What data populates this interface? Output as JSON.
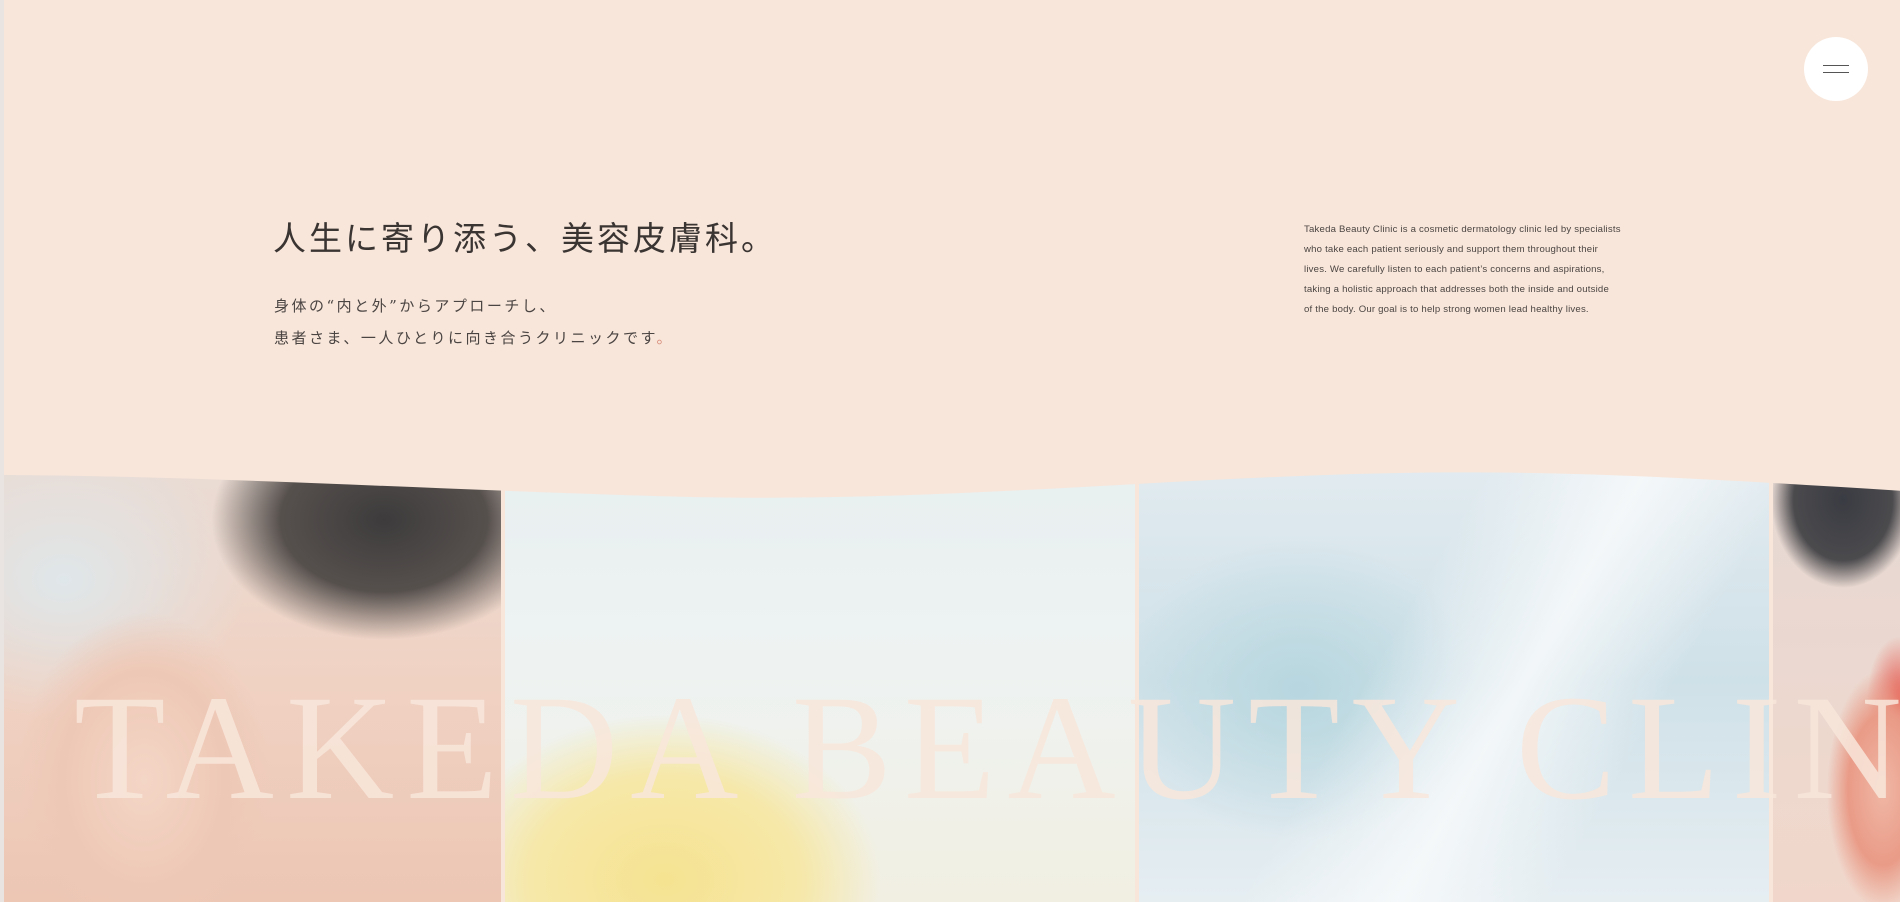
{
  "header": {
    "menu_icon": "hamburger-menu-icon"
  },
  "hero": {
    "headline": "人生に寄り添う、美容皮膚科。",
    "subline_1": "身体の“内と外”からアプローチし、",
    "subline_2_main": "患者さま、一人ひとりに向き合うクリニックです",
    "subline_2_end": "。"
  },
  "about": {
    "lines": [
      "Takeda Beauty Clinic is a cosmetic dermatology clinic led by specialists",
      "who take each patient seriously and support them throughout their",
      "lives. We carefully listen to each patient’s concerns and aspirations,",
      "taking a holistic approach that addresses both the inside and outside",
      "of the body. Our goal is to help strong women lead healthy lives."
    ]
  },
  "watermark": {
    "text": "TAKEDA BEAUTY CLINIC"
  },
  "colors": {
    "background": "#f8e6da",
    "text": "#3a3432",
    "accent_dot": "#d98d7b",
    "menu_button": "#ffffff"
  }
}
